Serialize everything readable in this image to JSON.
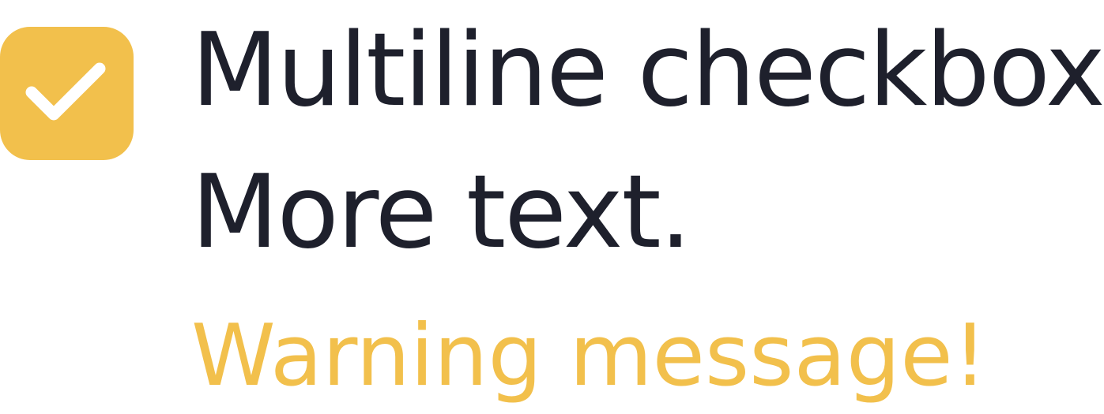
{
  "checkbox": {
    "checked": true,
    "label_lines": [
      "Multiline checkbox.",
      "More text."
    ],
    "warning": "Warning message!"
  },
  "colors": {
    "accent": "#F2C04C",
    "text": "#1E202C",
    "warning": "#F2C04C",
    "checkmark": "#FFFFFF"
  },
  "icons": {
    "check": "check-icon"
  }
}
